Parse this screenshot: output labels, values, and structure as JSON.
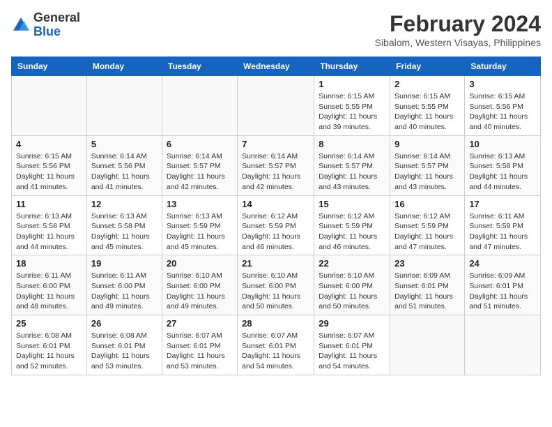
{
  "header": {
    "logo_line1": "General",
    "logo_line2": "Blue",
    "month_year": "February 2024",
    "location": "Sibalom, Western Visayas, Philippines"
  },
  "calendar": {
    "headers": [
      "Sunday",
      "Monday",
      "Tuesday",
      "Wednesday",
      "Thursday",
      "Friday",
      "Saturday"
    ],
    "weeks": [
      [
        {
          "day": "",
          "detail": ""
        },
        {
          "day": "",
          "detail": ""
        },
        {
          "day": "",
          "detail": ""
        },
        {
          "day": "",
          "detail": ""
        },
        {
          "day": "1",
          "detail": "Sunrise: 6:15 AM\nSunset: 5:55 PM\nDaylight: 11 hours\nand 39 minutes."
        },
        {
          "day": "2",
          "detail": "Sunrise: 6:15 AM\nSunset: 5:55 PM\nDaylight: 11 hours\nand 40 minutes."
        },
        {
          "day": "3",
          "detail": "Sunrise: 6:15 AM\nSunset: 5:56 PM\nDaylight: 11 hours\nand 40 minutes."
        }
      ],
      [
        {
          "day": "4",
          "detail": "Sunrise: 6:15 AM\nSunset: 5:56 PM\nDaylight: 11 hours\nand 41 minutes."
        },
        {
          "day": "5",
          "detail": "Sunrise: 6:14 AM\nSunset: 5:56 PM\nDaylight: 11 hours\nand 41 minutes."
        },
        {
          "day": "6",
          "detail": "Sunrise: 6:14 AM\nSunset: 5:57 PM\nDaylight: 11 hours\nand 42 minutes."
        },
        {
          "day": "7",
          "detail": "Sunrise: 6:14 AM\nSunset: 5:57 PM\nDaylight: 11 hours\nand 42 minutes."
        },
        {
          "day": "8",
          "detail": "Sunrise: 6:14 AM\nSunset: 5:57 PM\nDaylight: 11 hours\nand 43 minutes."
        },
        {
          "day": "9",
          "detail": "Sunrise: 6:14 AM\nSunset: 5:57 PM\nDaylight: 11 hours\nand 43 minutes."
        },
        {
          "day": "10",
          "detail": "Sunrise: 6:13 AM\nSunset: 5:58 PM\nDaylight: 11 hours\nand 44 minutes."
        }
      ],
      [
        {
          "day": "11",
          "detail": "Sunrise: 6:13 AM\nSunset: 5:58 PM\nDaylight: 11 hours\nand 44 minutes."
        },
        {
          "day": "12",
          "detail": "Sunrise: 6:13 AM\nSunset: 5:58 PM\nDaylight: 11 hours\nand 45 minutes."
        },
        {
          "day": "13",
          "detail": "Sunrise: 6:13 AM\nSunset: 5:59 PM\nDaylight: 11 hours\nand 45 minutes."
        },
        {
          "day": "14",
          "detail": "Sunrise: 6:12 AM\nSunset: 5:59 PM\nDaylight: 11 hours\nand 46 minutes."
        },
        {
          "day": "15",
          "detail": "Sunrise: 6:12 AM\nSunset: 5:59 PM\nDaylight: 11 hours\nand 46 minutes."
        },
        {
          "day": "16",
          "detail": "Sunrise: 6:12 AM\nSunset: 5:59 PM\nDaylight: 11 hours\nand 47 minutes."
        },
        {
          "day": "17",
          "detail": "Sunrise: 6:11 AM\nSunset: 5:59 PM\nDaylight: 11 hours\nand 47 minutes."
        }
      ],
      [
        {
          "day": "18",
          "detail": "Sunrise: 6:11 AM\nSunset: 6:00 PM\nDaylight: 11 hours\nand 48 minutes."
        },
        {
          "day": "19",
          "detail": "Sunrise: 6:11 AM\nSunset: 6:00 PM\nDaylight: 11 hours\nand 49 minutes."
        },
        {
          "day": "20",
          "detail": "Sunrise: 6:10 AM\nSunset: 6:00 PM\nDaylight: 11 hours\nand 49 minutes."
        },
        {
          "day": "21",
          "detail": "Sunrise: 6:10 AM\nSunset: 6:00 PM\nDaylight: 11 hours\nand 50 minutes."
        },
        {
          "day": "22",
          "detail": "Sunrise: 6:10 AM\nSunset: 6:00 PM\nDaylight: 11 hours\nand 50 minutes."
        },
        {
          "day": "23",
          "detail": "Sunrise: 6:09 AM\nSunset: 6:01 PM\nDaylight: 11 hours\nand 51 minutes."
        },
        {
          "day": "24",
          "detail": "Sunrise: 6:09 AM\nSunset: 6:01 PM\nDaylight: 11 hours\nand 51 minutes."
        }
      ],
      [
        {
          "day": "25",
          "detail": "Sunrise: 6:08 AM\nSunset: 6:01 PM\nDaylight: 11 hours\nand 52 minutes."
        },
        {
          "day": "26",
          "detail": "Sunrise: 6:08 AM\nSunset: 6:01 PM\nDaylight: 11 hours\nand 53 minutes."
        },
        {
          "day": "27",
          "detail": "Sunrise: 6:07 AM\nSunset: 6:01 PM\nDaylight: 11 hours\nand 53 minutes."
        },
        {
          "day": "28",
          "detail": "Sunrise: 6:07 AM\nSunset: 6:01 PM\nDaylight: 11 hours\nand 54 minutes."
        },
        {
          "day": "29",
          "detail": "Sunrise: 6:07 AM\nSunset: 6:01 PM\nDaylight: 11 hours\nand 54 minutes."
        },
        {
          "day": "",
          "detail": ""
        },
        {
          "day": "",
          "detail": ""
        }
      ]
    ]
  }
}
